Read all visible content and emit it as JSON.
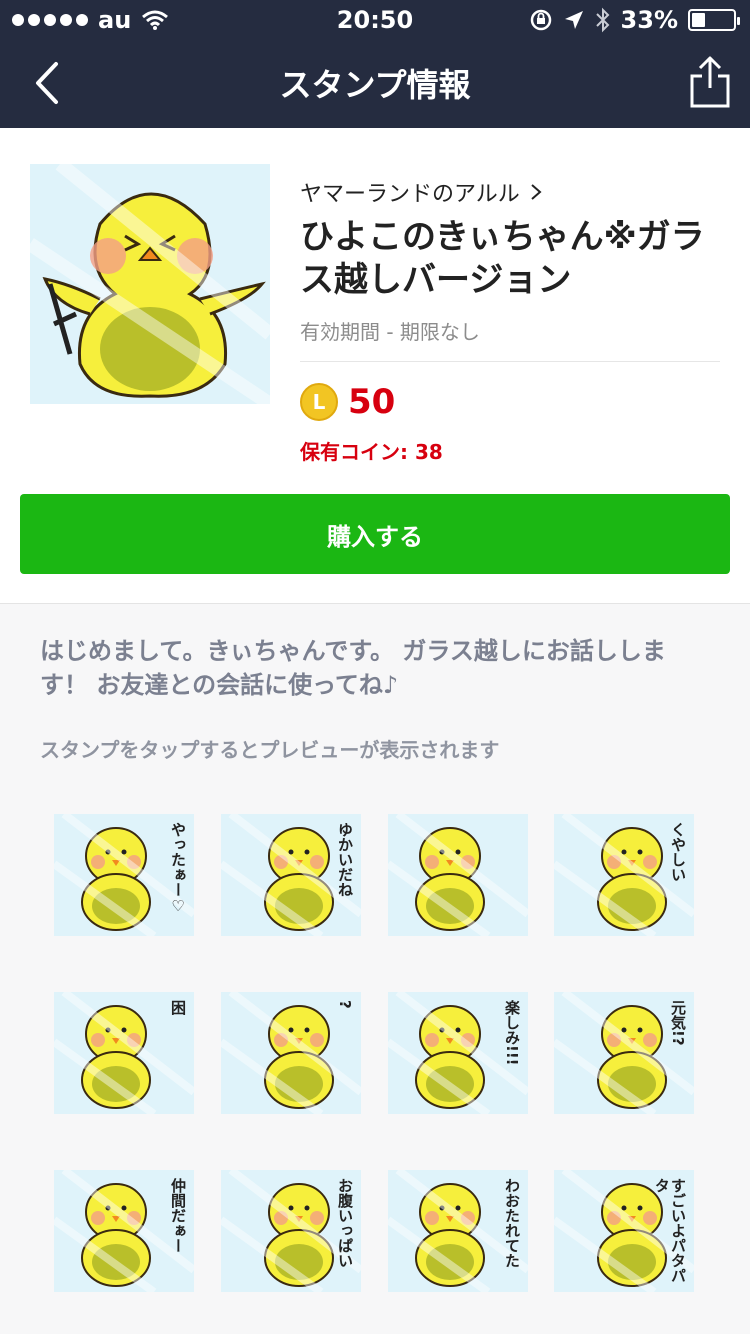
{
  "status_bar": {
    "carrier": "au",
    "time": "20:50",
    "battery": "33%",
    "battery_level": 0.33
  },
  "nav": {
    "title": "スタンプ情報"
  },
  "product": {
    "author": "ヤマーランドのアルル",
    "title": "ひよこのきぃちゃん※ガラス越しバージョン",
    "validity": "有効期間 - 期限なし",
    "coin_letter": "L",
    "price": "50",
    "owned_coins": "保有コイン: 38",
    "buy_label": "購入する"
  },
  "description": "はじめまして。きぃちゃんです。 ガラス越しにお話しします！ お友達との会話に使ってね♪",
  "hint": "スタンプをタップするとプレビューが表示されます",
  "stickers": [
    {
      "label": "やったぁー♡"
    },
    {
      "label": "ゆかいだね"
    },
    {
      "label": ""
    },
    {
      "label": "くやしい"
    },
    {
      "label": "困"
    },
    {
      "label": "?"
    },
    {
      "label": "楽しみ!!!"
    },
    {
      "label": "元気!?"
    },
    {
      "label": "仲間だぁー"
    },
    {
      "label": "お腹いっぱい"
    },
    {
      "label": "わおたれてた"
    },
    {
      "label": "すごいよパタパタ"
    }
  ],
  "colors": {
    "nav_bg": "#252c40",
    "buy_green": "#1bb713",
    "price_red": "#d7000f",
    "coin_gold": "#f2c523"
  },
  "icons": [
    "back-chevron-icon",
    "share-icon",
    "wifi-icon",
    "rotation-lock-icon",
    "location-arrow-icon",
    "bluetooth-icon",
    "battery-icon",
    "chevron-right-icon",
    "coin-icon"
  ]
}
